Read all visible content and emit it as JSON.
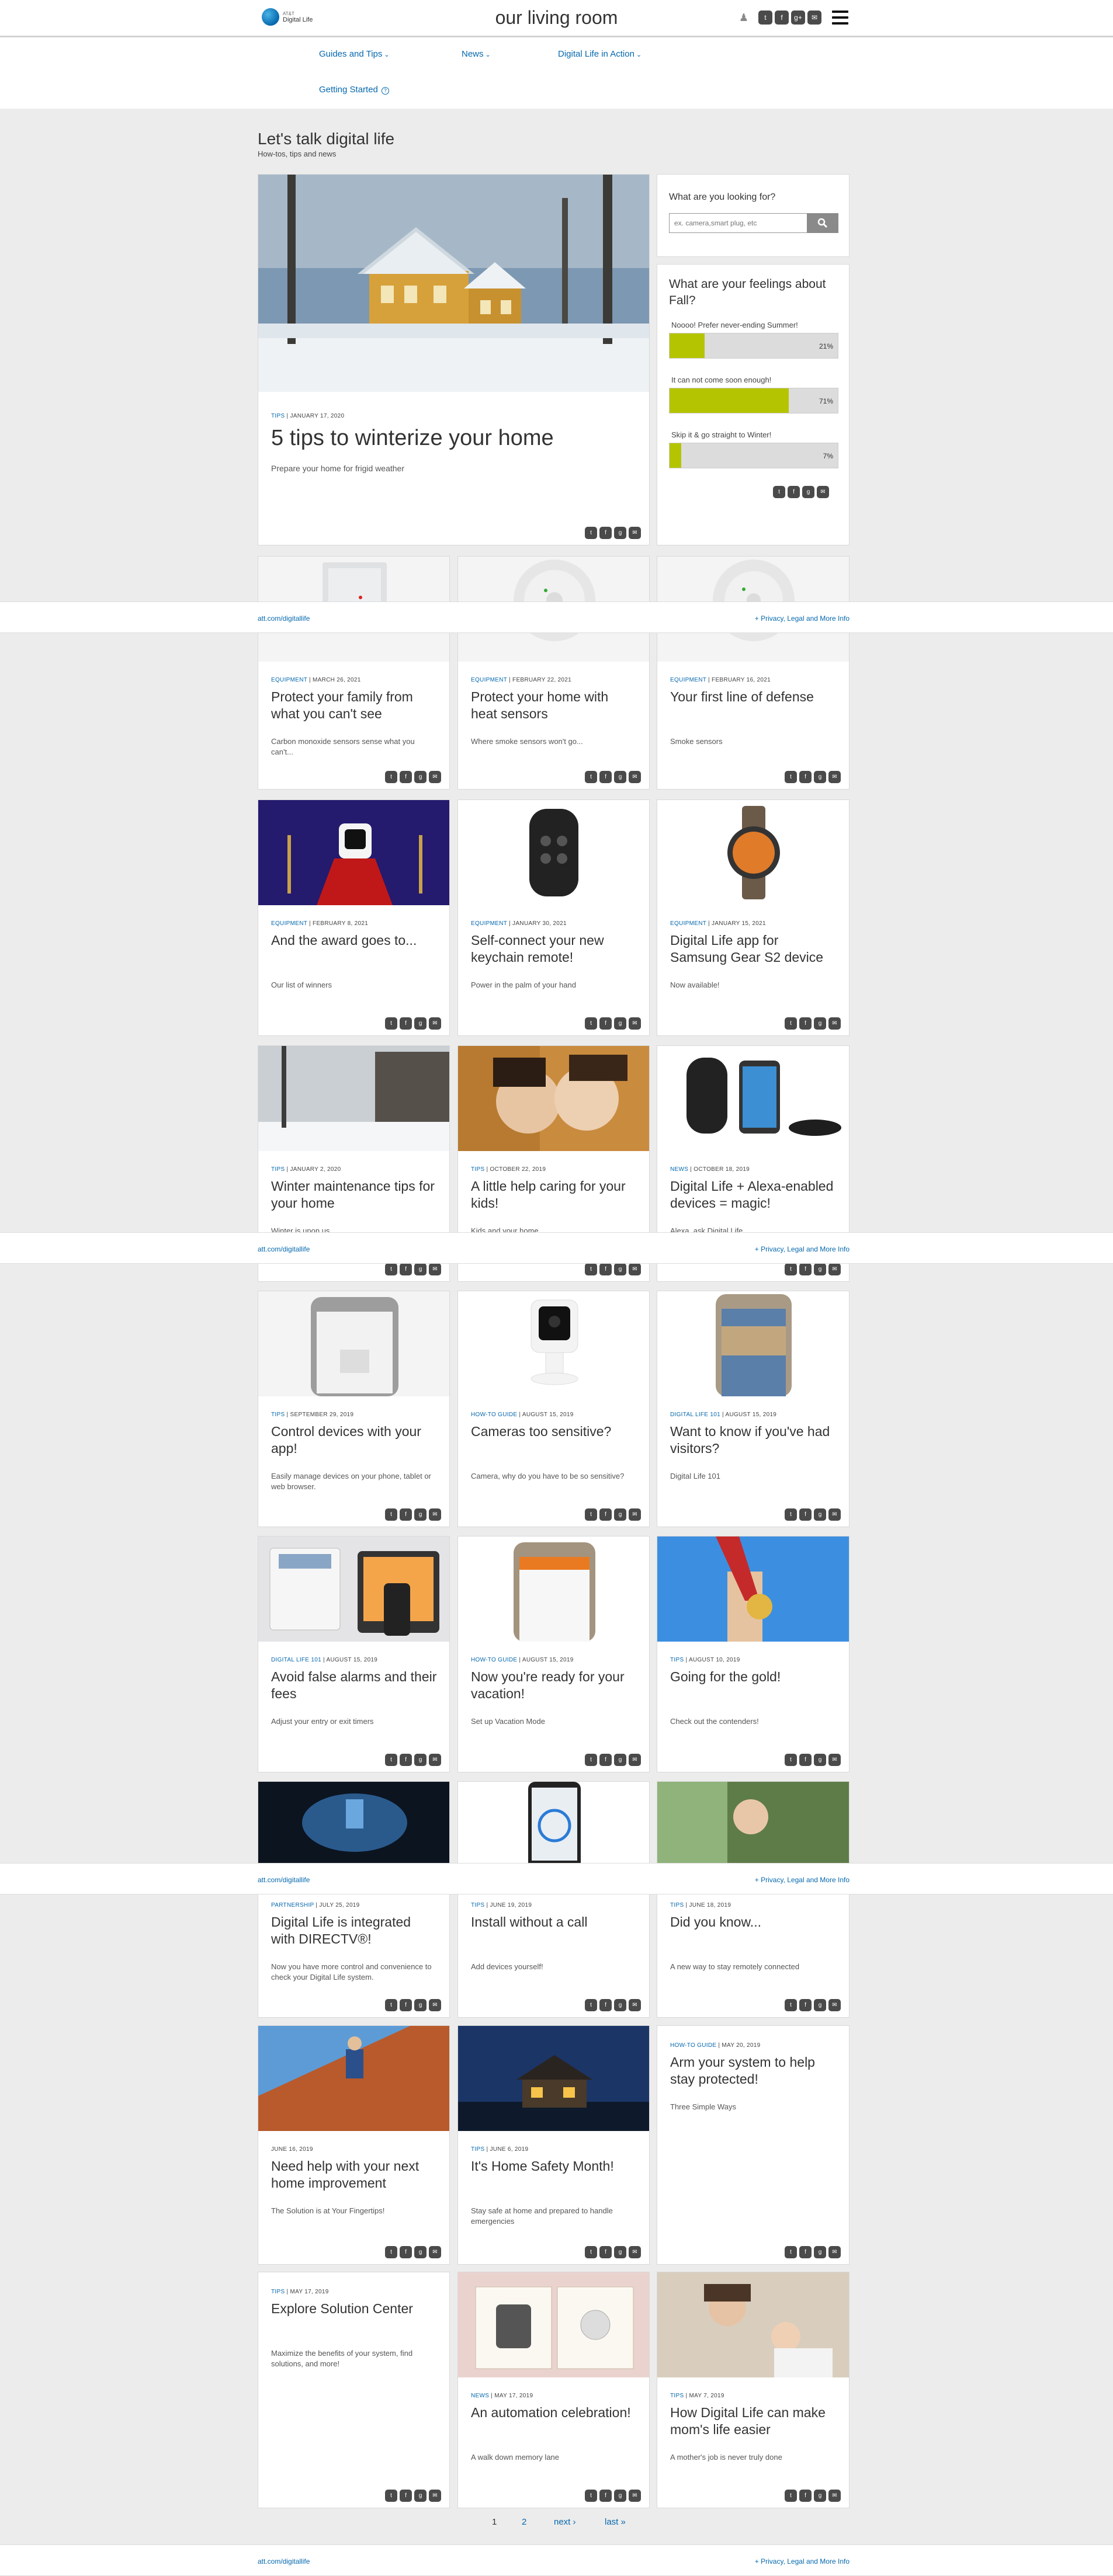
{
  "header": {
    "logo_top": "AT&T",
    "logo_bottom": "Digital Life",
    "title": "our living room",
    "social_icons": [
      "people-icon",
      "twitter-icon",
      "facebook-icon",
      "googleplus-icon",
      "email-icon"
    ]
  },
  "nav": {
    "items": [
      {
        "label": "Guides and Tips"
      },
      {
        "label": "News"
      },
      {
        "label": "Digital Life in Action"
      },
      {
        "label": "Getting Started"
      }
    ]
  },
  "intro": {
    "heading": "Let's talk digital life",
    "subheading": "How-tos, tips and news"
  },
  "search": {
    "title": "What are you looking for?",
    "placeholder": "ex. camera,smart plug, etc"
  },
  "poll": {
    "question": "What are your feelings about Fall?",
    "options": [
      {
        "label": "Noooo! Prefer never-ending Summer!",
        "percent": 21,
        "pct_text": "21%"
      },
      {
        "label": "It can not come soon enough!",
        "percent": 71,
        "pct_text": "71%"
      },
      {
        "label": "Skip it & go straight to Winter!",
        "percent": 7,
        "pct_text": "7%"
      }
    ]
  },
  "featured": {
    "category": "TIPS",
    "date": "JANUARY 17, 2020",
    "title": "5 tips to winterize your home",
    "subtitle": "Prepare your home for frigid weather"
  },
  "cards": [
    {
      "category": "EQUIPMENT",
      "date": "MARCH 26, 2021",
      "title": "Protect your family from what you can't see",
      "subtitle": "Carbon monoxide sensors sense what you can't..."
    },
    {
      "category": "EQUIPMENT",
      "date": "FEBRUARY 22, 2021",
      "title": "Protect your home with heat sensors",
      "subtitle": "Where smoke sensors won't go..."
    },
    {
      "category": "EQUIPMENT",
      "date": "FEBRUARY 16, 2021",
      "title": "Your first line of defense",
      "subtitle": "Smoke sensors"
    },
    {
      "category": "EQUIPMENT",
      "date": "FEBRUARY 8, 2021",
      "title": "And the award goes to...",
      "subtitle": "Our list of winners"
    },
    {
      "category": "EQUIPMENT",
      "date": "JANUARY 30, 2021",
      "title": "Self-connect your new keychain remote!",
      "subtitle": "Power in the palm of your hand"
    },
    {
      "category": "EQUIPMENT",
      "date": "JANUARY 15, 2021",
      "title": "Digital Life app for Samsung Gear S2 device",
      "subtitle": "Now available!"
    },
    {
      "category": "TIPS",
      "date": "JANUARY 2, 2020",
      "title": "Winter maintenance tips for your home",
      "subtitle": "Winter is upon us."
    },
    {
      "category": "TIPS",
      "date": "OCTOBER 22, 2019",
      "title": "A little help caring for your kids!",
      "subtitle": "Kids and your home."
    },
    {
      "category": "NEWS",
      "date": "OCTOBER 18, 2019",
      "title": "Digital Life + Alexa-enabled devices = magic!",
      "subtitle": "Alexa, ask Digital Life"
    },
    {
      "category": "TIPS",
      "date": "SEPTEMBER 29, 2019",
      "title": "Control devices with your app!",
      "subtitle": "Easily manage devices on your phone, tablet or web browser."
    },
    {
      "category": "HOW-TO GUIDE",
      "date": "AUGUST 15, 2019",
      "title": "Cameras too sensitive?",
      "subtitle": "Camera, why do you have to be so sensitive?"
    },
    {
      "category": "DIGITAL LIFE 101",
      "date": "AUGUST 15, 2019",
      "title": "Want to know if you've had visitors?",
      "subtitle": "Digital Life 101"
    },
    {
      "category": "DIGITAL LIFE 101",
      "date": "AUGUST 15, 2019",
      "title": "Avoid false alarms and their fees",
      "subtitle": "Adjust your entry or exit timers"
    },
    {
      "category": "HOW-TO GUIDE",
      "date": "AUGUST 15, 2019",
      "title": "Now you're ready for your vacation!",
      "subtitle": "Set up Vacation Mode"
    },
    {
      "category": "TIPS",
      "date": "AUGUST 10, 2019",
      "title": "Going for the gold!",
      "subtitle": "Check out the contenders!"
    },
    {
      "category": "PARTNERSHIP",
      "date": "JULY 25, 2019",
      "title": "Digital Life is integrated with DIRECTV®!",
      "subtitle": "Now you have more control and convenience to check your Digital Life system."
    },
    {
      "category": "TIPS",
      "date": "JUNE 19, 2019",
      "title": "Install without a call",
      "subtitle": "Add devices yourself!"
    },
    {
      "category": "TIPS",
      "date": "JUNE 18, 2019",
      "title": "Did you know...",
      "subtitle": "A new way to stay remotely connected"
    },
    {
      "category": "",
      "date": "JUNE 16, 2019",
      "title": "Need help with your next home improvement",
      "subtitle": "The Solution is at Your Fingertips!"
    },
    {
      "category": "TIPS",
      "date": "JUNE 6, 2019",
      "title": "It's Home Safety Month!",
      "subtitle": "Stay safe at home and prepared to handle emergencies"
    },
    {
      "category": "HOW-TO GUIDE",
      "date": "MAY 20, 2019",
      "title": "Arm your system to help stay protected!",
      "subtitle": "Three Simple Ways"
    },
    {
      "category": "TIPS",
      "date": "MAY 17, 2019",
      "title": "Explore Solution Center",
      "subtitle": "Maximize the benefits of your system, find solutions, and more!"
    },
    {
      "category": "NEWS",
      "date": "MAY 17, 2019",
      "title": "An automation celebration!",
      "subtitle": "A walk down memory lane"
    },
    {
      "category": "TIPS",
      "date": "MAY 7, 2019",
      "title": "How Digital Life can make mom's life easier",
      "subtitle": "A mother's job is never truly done"
    }
  ],
  "footer": {
    "left": "att.com/digitallife",
    "right": "+ Privacy, Legal and More Info"
  },
  "pagination": {
    "current": "1",
    "page2": "2",
    "next": "next ›",
    "last": "last »"
  },
  "share_icons": [
    "twitter-icon",
    "facebook-icon",
    "googleplus-icon",
    "email-icon"
  ],
  "colors": {
    "accent": "#0568ae",
    "poll_bar": "#b5c400",
    "icon_bg": "#4a4a4a",
    "page_bg": "#ececec"
  }
}
